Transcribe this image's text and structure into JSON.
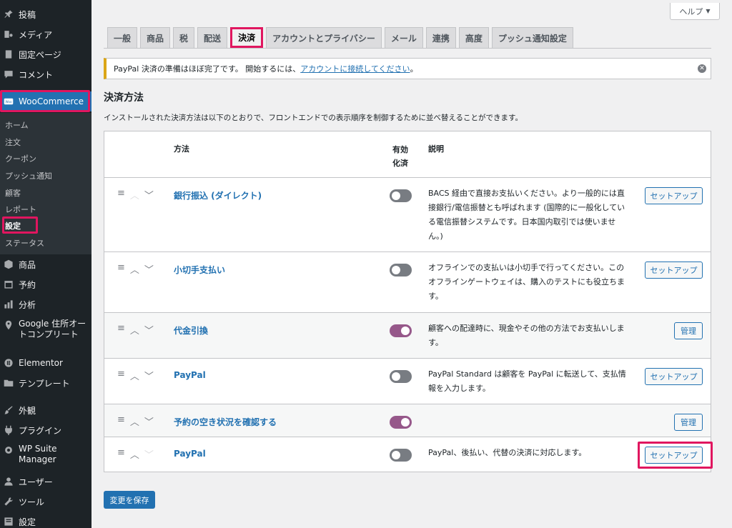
{
  "sidebar": {
    "items": [
      {
        "label": "投稿",
        "icon": "pin-icon"
      },
      {
        "label": "メディア",
        "icon": "media-icon"
      },
      {
        "label": "固定ページ",
        "icon": "page-icon"
      },
      {
        "label": "コメント",
        "icon": "comment-icon"
      },
      {
        "label": "WooCommerce",
        "icon": "woo-icon"
      },
      {
        "label": "商品",
        "icon": "box-icon"
      },
      {
        "label": "予約",
        "icon": "calendar-icon"
      },
      {
        "label": "分析",
        "icon": "chart-icon"
      },
      {
        "label": "Google 住所オートコンプリート",
        "label_line1": "Google 住所オー",
        "label_line2": "トコンプリート",
        "icon": "location-icon"
      },
      {
        "label": "Elementor",
        "icon": "elementor-icon"
      },
      {
        "label": "テンプレート",
        "icon": "folder-icon"
      },
      {
        "label": "外観",
        "icon": "brush-icon"
      },
      {
        "label": "プラグイン",
        "icon": "plugin-icon"
      },
      {
        "label": "WP Suite Manager",
        "label_line1": "WP Suite",
        "label_line2": "Manager",
        "icon": "gear-icon"
      },
      {
        "label": "ユーザー",
        "icon": "user-icon"
      },
      {
        "label": "ツール",
        "icon": "wrench-icon"
      },
      {
        "label": "設定",
        "icon": "settings-icon"
      }
    ],
    "submenu": [
      "ホーム",
      "注文",
      "クーポン",
      "プッシュ通知",
      "顧客",
      "レポート",
      "設定",
      "ステータス"
    ]
  },
  "help": {
    "label": "ヘルプ",
    "arrow": "▼"
  },
  "tabs": [
    "一般",
    "商品",
    "税",
    "配送",
    "決済",
    "アカウントとプライバシー",
    "メール",
    "連携",
    "高度",
    "プッシュ通知設定"
  ],
  "notice": {
    "text_before": "PayPal 決済の準備はほぼ完了です。 開始するには、",
    "link": "アカウントに接続してください",
    "text_after": "。"
  },
  "section": {
    "title": "決済方法",
    "description": "インストールされた決済方法は以下のとおりで、フロントエンドでの表示順序を制御するために並べ替えることができます。"
  },
  "table": {
    "headers": {
      "method": "方法",
      "enabled_line1": "有効",
      "enabled_line2": "化済",
      "description": "説明"
    },
    "rows": [
      {
        "name": "銀行振込 (ダイレクト)",
        "enabled": false,
        "desc": "BACS 経由で直接お支払いください。より一般的には直接銀行/電信振替とも呼ばれます (国際的に一般化している電信振替システムです。日本国内取引では使いません。)",
        "action": "セットアップ"
      },
      {
        "name": "小切手支払い",
        "enabled": false,
        "desc": "オフラインでの支払いは小切手で行ってください。このオフラインゲートウェイは、購入のテストにも役立ちます。",
        "action": "セットアップ"
      },
      {
        "name": "代金引換",
        "enabled": true,
        "desc": "顧客への配達時に、現金やその他の方法でお支払いします。",
        "action": "管理"
      },
      {
        "name": "PayPal",
        "enabled": false,
        "desc": "PayPal Standard は顧客を PayPal に転送して、支払情報を入力します。",
        "action": "セットアップ"
      },
      {
        "name": "予約の空き状況を確認する",
        "enabled": true,
        "desc": "",
        "action": "管理"
      },
      {
        "name": "PayPal",
        "enabled": false,
        "desc": "PayPal、後払い、代替の決済に対応します。",
        "action": "セットアップ"
      }
    ]
  },
  "save_label": "変更を保存",
  "colors": {
    "accent": "#2271b1",
    "highlight": "#e0165f",
    "toggle_on": "#96588a",
    "sidebar": "#1d2327",
    "notice_border": "#dba617"
  }
}
